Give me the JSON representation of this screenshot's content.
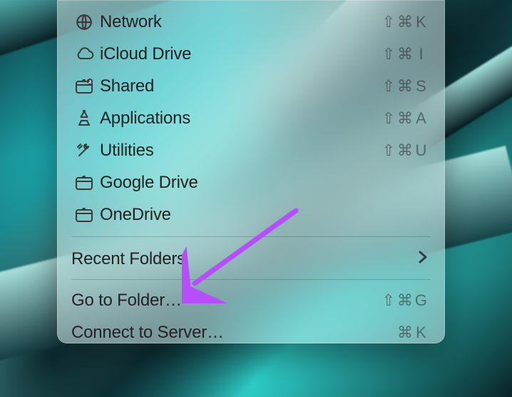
{
  "menu": {
    "items": [
      {
        "icon": "globe-icon",
        "label": "Network",
        "shortcut": [
          "⇧",
          "⌘",
          "K"
        ]
      },
      {
        "icon": "cloud-icon",
        "label": "iCloud Drive",
        "shortcut": [
          "⇧",
          "⌘",
          "I"
        ]
      },
      {
        "icon": "shared-icon",
        "label": "Shared",
        "shortcut": [
          "⇧",
          "⌘",
          "S"
        ]
      },
      {
        "icon": "apps-icon",
        "label": "Applications",
        "shortcut": [
          "⇧",
          "⌘",
          "A"
        ]
      },
      {
        "icon": "utilities-icon",
        "label": "Utilities",
        "shortcut": [
          "⇧",
          "⌘",
          "U"
        ]
      },
      {
        "icon": "folder-icon",
        "label": "Google Drive"
      },
      {
        "icon": "folder-icon",
        "label": "OneDrive"
      }
    ],
    "recent_label": "Recent Folders",
    "goto_label": "Go to Folder…",
    "goto_shortcut": [
      "⇧",
      "⌘",
      "G"
    ],
    "connect_label": "Connect to Server…",
    "connect_shortcut": [
      "⌘",
      "K"
    ]
  },
  "annotation": {
    "arrow_color": "#b84dff"
  }
}
